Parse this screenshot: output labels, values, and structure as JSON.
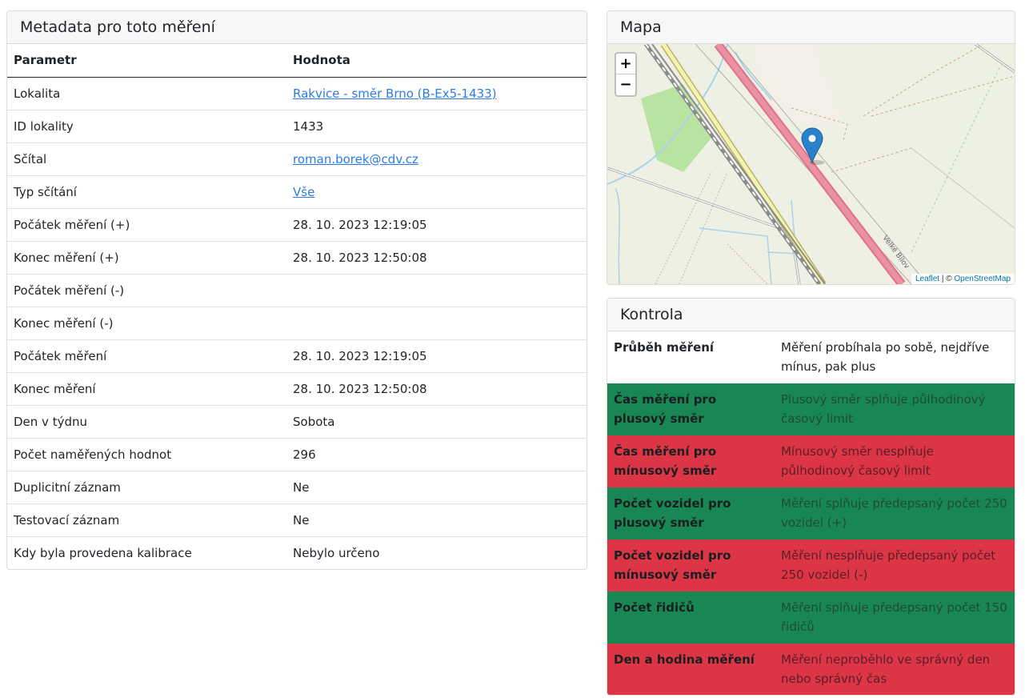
{
  "metadata": {
    "title": "Metadata pro toto měření",
    "header_param": "Parametr",
    "header_value": "Hodnota",
    "rows": [
      {
        "label": "Lokalita",
        "value": "Rakvice - směr Brno (B-Ex5-1433)",
        "link": true
      },
      {
        "label": "ID lokality",
        "value": "1433"
      },
      {
        "label": "Sčítal",
        "value": "roman.borek@cdv.cz",
        "link": true
      },
      {
        "label": "Typ sčítání",
        "value": "Vše",
        "link": true
      },
      {
        "label": "Počátek měření (+)",
        "value": "28. 10. 2023 12:19:05"
      },
      {
        "label": "Konec měření (+)",
        "value": "28. 10. 2023 12:50:08"
      },
      {
        "label": "Počátek měření (-)",
        "value": ""
      },
      {
        "label": "Konec měření (-)",
        "value": ""
      },
      {
        "label": "Počátek měření",
        "value": "28. 10. 2023 12:19:05"
      },
      {
        "label": "Konec měření",
        "value": "28. 10. 2023 12:50:08"
      },
      {
        "label": "Den v týdnu",
        "value": "Sobota"
      },
      {
        "label": "Počet naměřených hodnot",
        "value": "296"
      },
      {
        "label": "Duplicitní záznam",
        "value": "Ne"
      },
      {
        "label": "Testovací záznam",
        "value": "Ne"
      },
      {
        "label": "Kdy byla provedena kalibrace",
        "value": "Nebylo určeno"
      }
    ]
  },
  "map": {
    "title": "Mapa",
    "zoom_in": "+",
    "zoom_out": "−",
    "attrib_leaflet": "Leaflet",
    "attrib_sep": " | © ",
    "attrib_osm": "OpenStreetMap",
    "road_label": "Velké Bílov",
    "marker_icon": "map-marker-icon"
  },
  "control": {
    "title": "Kontrola",
    "rows": [
      {
        "label": "Průběh měření",
        "text": "Měření probíhala po sobě, nejdříve mínus, pak plus",
        "status": "neutral"
      },
      {
        "label": "Čas měření pro plusový směr",
        "text": "Plusový směr splňuje půlhodinový časový limit",
        "status": "ok"
      },
      {
        "label": "Čas měření pro mínusový směr",
        "text": "Mínusový směr nesplňuje půlhodinový časový limit",
        "status": "fail"
      },
      {
        "label": "Počet vozidel pro plusový směr",
        "text": "Měření splňuje předepsaný počet 250 vozidel (+)",
        "status": "ok"
      },
      {
        "label": "Počet vozidel pro mínusový směr",
        "text": "Měření nesplňuje předepsaný počet 250 vozidel (-)",
        "status": "fail"
      },
      {
        "label": "Počet řidičů",
        "text": "Měření splňuje předepsaný počet 150 řidičů",
        "status": "ok"
      },
      {
        "label": "Den a hodina měření",
        "text": "Měření neproběhlo ve správný den nebo správný čas",
        "status": "fail"
      }
    ],
    "colors": {
      "ok": "#198754",
      "fail": "#dc3545"
    }
  }
}
